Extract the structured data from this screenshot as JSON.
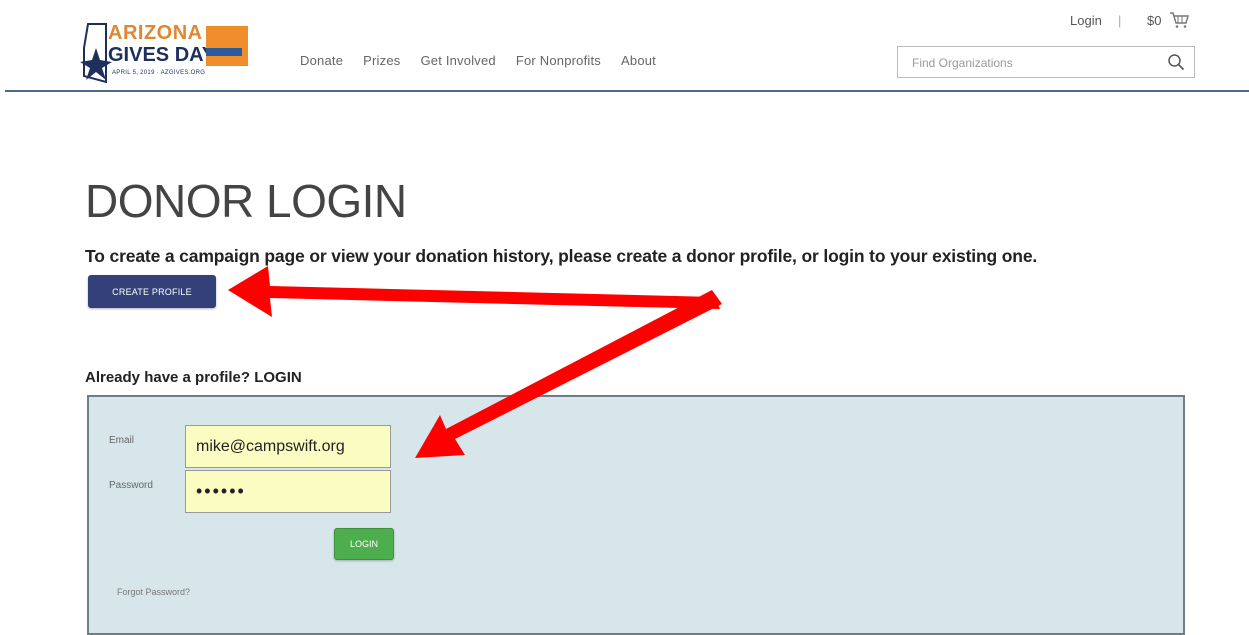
{
  "brand": {
    "logo_line1": "ARIZONA",
    "logo_line2": "GIVES DAY",
    "logo_line3": "APRIL 5, 2019 · AZGIVES.ORG",
    "primary_color": "#33407a",
    "accent_color": "#ef8c2b"
  },
  "header": {
    "login_label": "Login",
    "divider": "|",
    "cart_amount": "$0",
    "cart_icon": "cart-icon",
    "nav": [
      {
        "label": "Donate"
      },
      {
        "label": "Prizes"
      },
      {
        "label": "Get Involved"
      },
      {
        "label": "For Nonprofits"
      },
      {
        "label": "About"
      }
    ],
    "search": {
      "placeholder": "Find Organizations",
      "icon": "search-icon"
    }
  },
  "main": {
    "title": "DONOR LOGIN",
    "intro": "To create a campaign page or view your donation history, please create a donor profile, or login to your existing one.",
    "create_button": "CREATE PROFILE",
    "login_heading": "Already have a profile? LOGIN",
    "form": {
      "email_label": "Email",
      "email_value": "mike@campswift.org",
      "password_label": "Password",
      "password_value": "••••••",
      "login_button": "LOGIN",
      "forgot_link": "Forgot Password?",
      "field_color": "#fbfcc2",
      "panel_color": "#d6e6ea",
      "button_color": "#4cae4c"
    }
  },
  "annotation": {
    "arrow_color": "#ff0000"
  }
}
